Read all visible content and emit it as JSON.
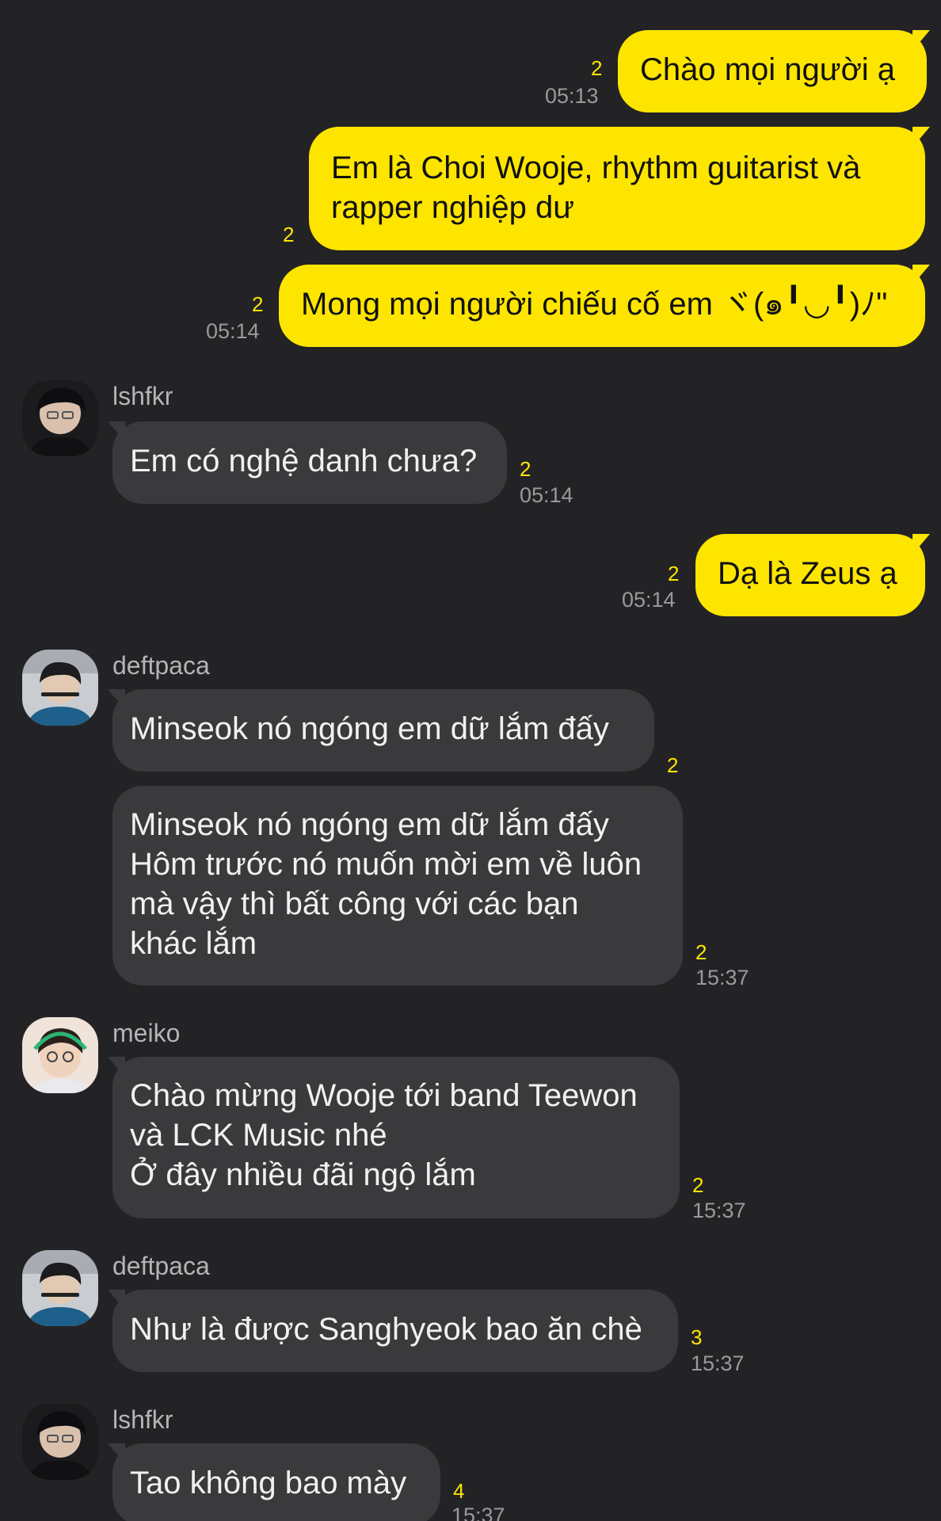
{
  "messages": [
    {
      "text": "Chào mọi người ạ",
      "unread": "2",
      "time": "05:13"
    },
    {
      "text": "Em là Choi Wooje, rhythm guitarist và\nrapper nghiệp dư",
      "unread": "2"
    },
    {
      "text": "Mong mọi người chiếu cố em ヾ(๑╹◡╹)ﾉ\"",
      "unread": "2",
      "time": "05:14"
    },
    {
      "sender": "lshfkr",
      "text": "Em có nghệ danh chưa?",
      "unread": "2",
      "time": "05:14"
    },
    {
      "text": "Dạ là Zeus ạ",
      "unread": "2",
      "time": "05:14"
    },
    {
      "sender": "deftpaca",
      "text": "Minseok nó ngóng em dữ lắm đấy",
      "unread": "2"
    },
    {
      "text": "Minseok nó ngóng em dữ lắm đấy\nHôm trước nó muốn mời em về luôn\nmà vậy thì bất công với các bạn\nkhác lắm",
      "unread": "2",
      "time": "15:37"
    },
    {
      "sender": "meiko",
      "text": "Chào mừng Wooje tới band Teewon\nvà LCK Music nhé\nỞ đây nhiều đãi ngộ lắm",
      "unread": "2",
      "time": "15:37"
    },
    {
      "sender": "deftpaca",
      "text": "Như là được Sanghyeok bao ăn chè",
      "unread": "3",
      "time": "15:37"
    },
    {
      "sender": "lshfkr",
      "text": "Tao không bao mày",
      "unread": "4",
      "time": "15:37"
    }
  ],
  "colors": {
    "background": "#232325",
    "my_bubble": "#fee500",
    "other_bubble": "#3a3a3d",
    "unread": "#fee500",
    "time": "#9a9a9d"
  }
}
